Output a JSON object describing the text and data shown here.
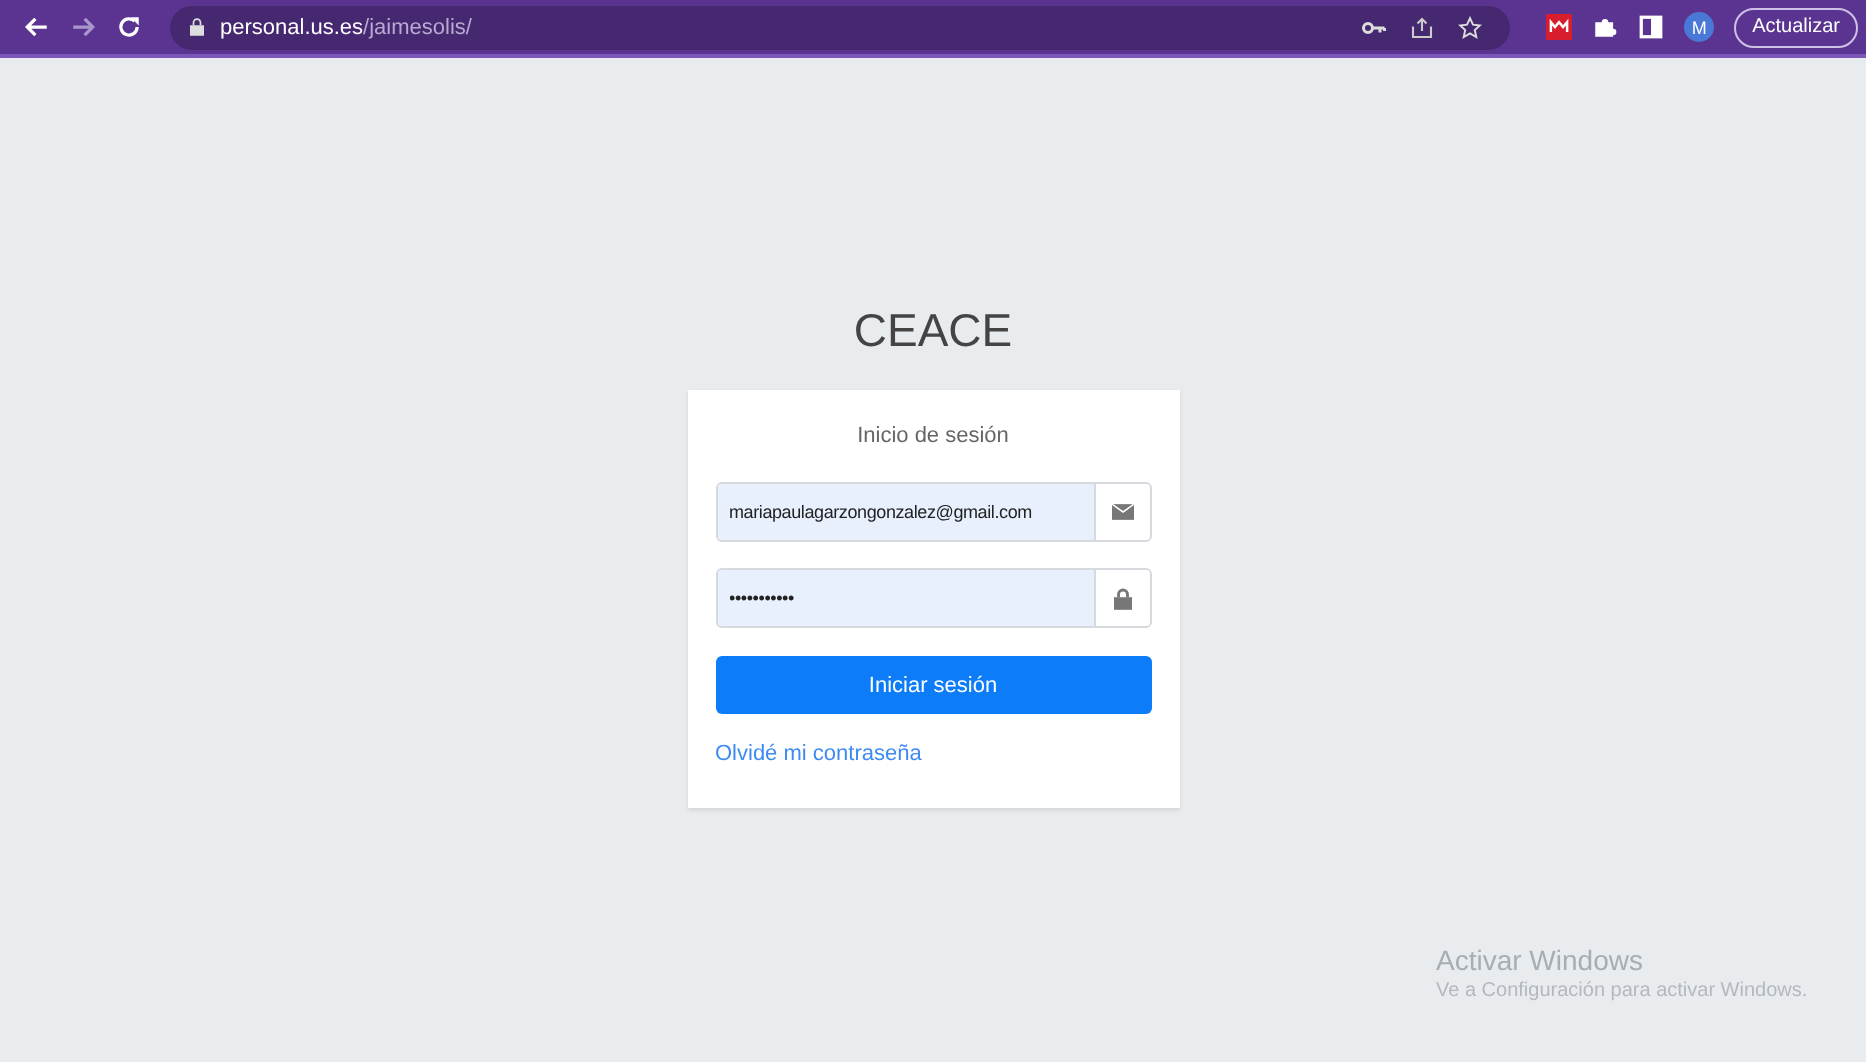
{
  "browser": {
    "url_host": "personal.us.es",
    "url_path": "/jaimesolis/",
    "profile_initial": "M",
    "update_button": "Actualizar"
  },
  "page": {
    "site_title": "CEACE",
    "login_card": {
      "heading": "Inicio de sesión",
      "email": {
        "value": "mariapaulagarzongonzalez@gmail.com"
      },
      "password": {
        "value": "•••••••••••"
      },
      "submit_button": "Iniciar sesión",
      "forgot_link": "Olvidé mi contraseña"
    }
  },
  "os_notice": {
    "title": "Activar Windows",
    "message": "Ve a Configuración para activar Windows."
  }
}
